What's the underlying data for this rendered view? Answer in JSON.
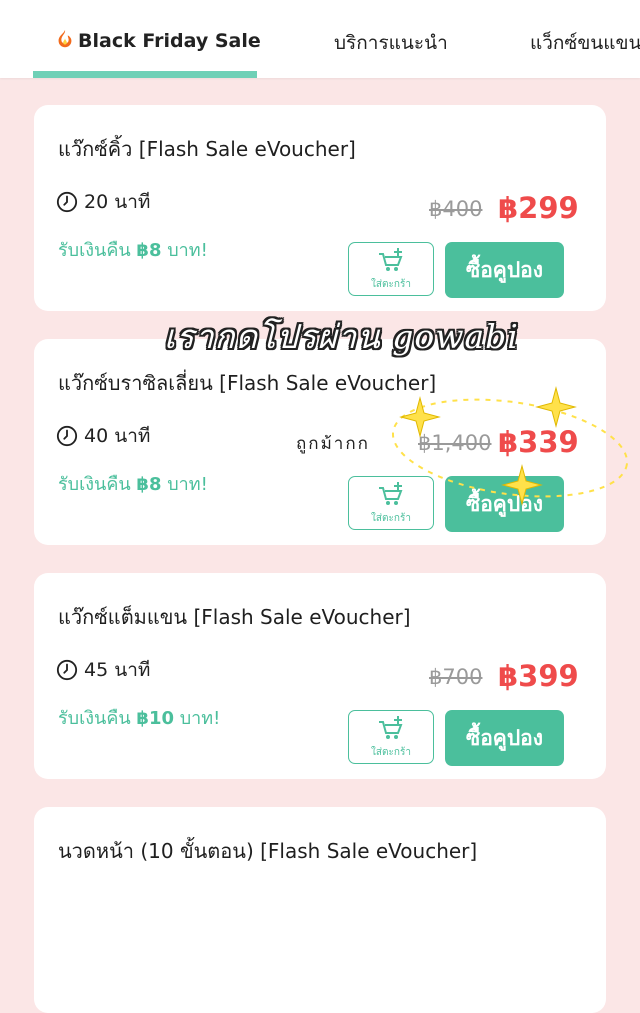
{
  "tabs": [
    {
      "label": "Black Friday Sale",
      "active": true,
      "icon": "fire-icon"
    },
    {
      "label": "บริการแนะนำ",
      "active": false
    },
    {
      "label": "แว็กซ์ขนแขน",
      "active": false
    }
  ],
  "products": [
    {
      "title": "แว๊กซ์คิ้ว [Flash Sale eVoucher]",
      "duration": "20 นาที",
      "cashback_prefix": "รับเงินคืน",
      "cashback_amount": "฿8",
      "cashback_suffix": "บาท!",
      "price_old": "฿400",
      "price_new": "฿299",
      "cart_label": "ใส่ตะกร้า",
      "buy_label": "ซื้อคูปอง"
    },
    {
      "title": "แว๊กซ์บราซิลเลี่ยน [Flash Sale eVoucher]",
      "duration": "40 นาที",
      "cashback_prefix": "รับเงินคืน",
      "cashback_amount": "฿8",
      "cashback_suffix": "บาท!",
      "price_old": "฿1,400",
      "price_new": "฿339",
      "cart_label": "ใส่ตะกร้า",
      "buy_label": "ซื้อคูปอง"
    },
    {
      "title": "แว๊กซ์แต็มแขน [Flash Sale eVoucher]",
      "duration": "45 นาที",
      "cashback_prefix": "รับเงินคืน",
      "cashback_amount": "฿10",
      "cashback_suffix": "บาท!",
      "price_old": "฿700",
      "price_new": "฿399",
      "cart_label": "ใส่ตะกร้า",
      "buy_label": "ซื้อคูปอง"
    },
    {
      "title": "นวดหน้า (10 ขั้นตอน) [Flash Sale eVoucher]"
    }
  ],
  "overlay": {
    "headline": "เรากดโปรผ่าน gowabi",
    "note": "ถูกม้ากก"
  },
  "colors": {
    "accent": "#4bbf9c",
    "price": "#ef4b4b",
    "background": "#fbe6e6",
    "sparkle": "#ffe14a"
  }
}
